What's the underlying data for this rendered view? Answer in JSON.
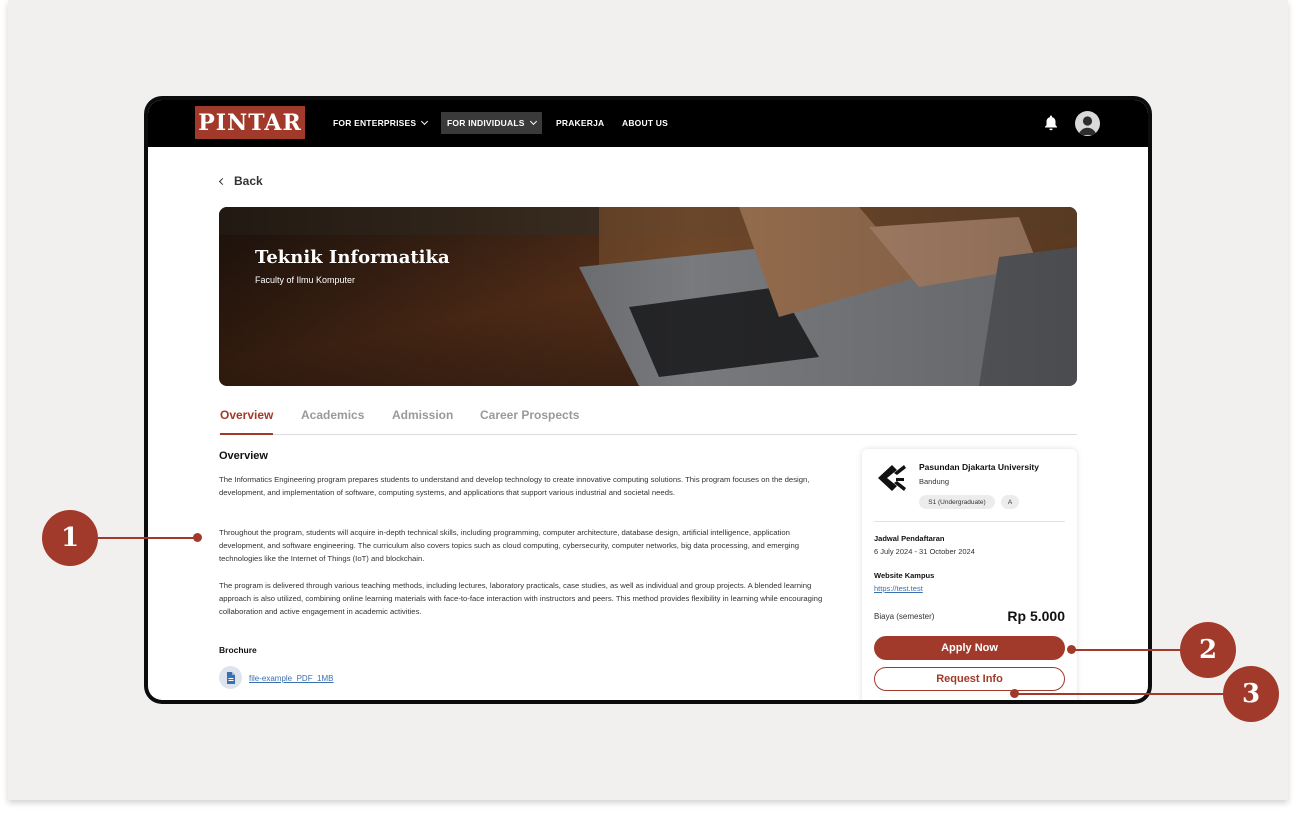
{
  "navbar": {
    "logo": "PINTAR",
    "items": [
      {
        "label": "FOR ENTERPRISES",
        "has_dropdown": true,
        "active": false
      },
      {
        "label": "FOR INDIVIDUALS",
        "has_dropdown": true,
        "active": true
      },
      {
        "label": "PRAKERJA",
        "has_dropdown": false,
        "active": false
      },
      {
        "label": "ABOUT US",
        "has_dropdown": false,
        "active": false
      }
    ],
    "icons": [
      "bell-icon",
      "user-avatar-icon"
    ]
  },
  "back_label": "Back",
  "hero": {
    "title": "Teknik Informatika",
    "subtitle": "Faculty of Ilmu Komputer"
  },
  "tabs": [
    "Overview",
    "Academics",
    "Admission",
    "Career Prospects"
  ],
  "overview": {
    "heading": "Overview",
    "paragraphs": [
      "The Informatics Engineering program prepares students to understand and develop technology to create innovative computing solutions. This program focuses on the design, development, and implementation of software, computing systems, and applications that support various industrial and societal needs.",
      "Throughout the program, students will acquire in-depth technical skills, including programming, computer architecture, database design, artificial intelligence, application development, and software engineering. The curriculum also covers topics such as cloud computing, cybersecurity, computer networks, big data processing, and emerging technologies like the Internet of Things (IoT) and blockchain.",
      "The program is delivered through various teaching methods, including lectures, laboratory practicals, case studies, as well as individual and group projects. A blended learning approach is also utilized, combining online learning materials with face-to-face interaction with instructors and peers. This method provides flexibility in learning while encouraging collaboration and active engagement in academic activities."
    ]
  },
  "brochure": {
    "heading": "Brochure",
    "file_name": "file-example_PDF_1MB"
  },
  "card": {
    "university": "Pasundan Djakarta University",
    "city": "Bandung",
    "degree_chip": "S1 (Undergraduate)",
    "accreditation_chip": "A",
    "schedule_label": "Jadwal Pendaftaran",
    "schedule_value": "6 July 2024 - 31 October 2024",
    "website_label": "Website Kampus",
    "website_value": "https://test.test",
    "fee_label": "Biaya (semester)",
    "fee_value": "Rp 5.000",
    "apply_label": "Apply Now",
    "request_label": "Request Info"
  },
  "callouts": [
    "1",
    "2",
    "3"
  ],
  "colors": {
    "brand": "#a23a2b",
    "navbar": "#000000",
    "canvas": "#f2f0ee",
    "link": "#3a6fb0"
  }
}
